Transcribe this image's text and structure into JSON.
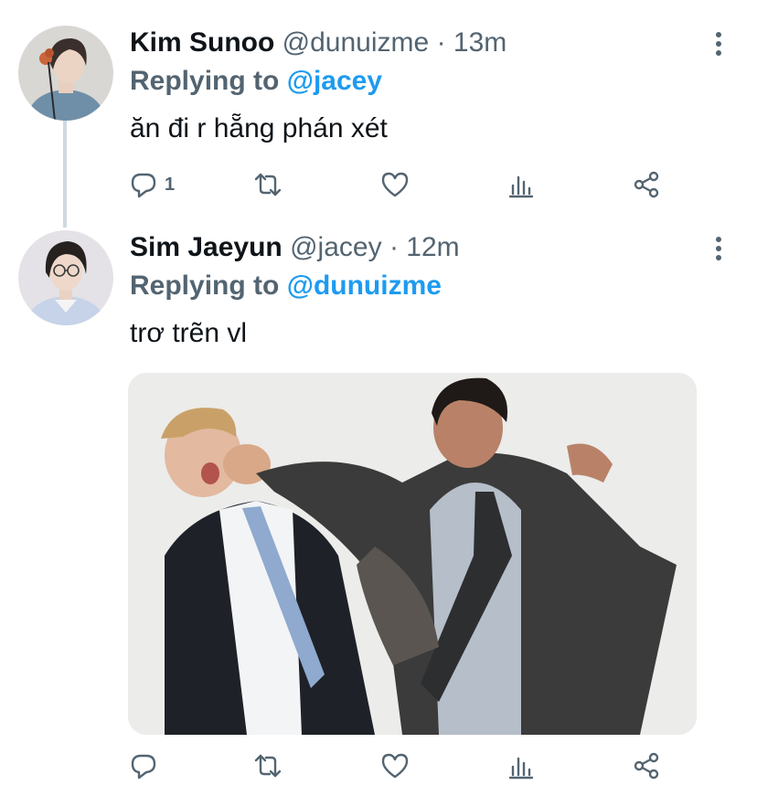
{
  "tweets": [
    {
      "display_name": "Kim Sunoo",
      "handle": "@dunuizme",
      "separator": "·",
      "time": "13m",
      "replying_label": "Replying to",
      "replying_to": "@jacey",
      "text": "ăn đi r hẵng phán xét",
      "reply_count": "1"
    },
    {
      "display_name": "Sim Jaeyun",
      "handle": "@jacey",
      "separator": "·",
      "time": "12m",
      "replying_label": "Replying to",
      "replying_to": "@dunuizme",
      "text": "trơ trẽn vl",
      "reply_count": ""
    }
  ],
  "icons": [
    "reply-icon",
    "retweet-icon",
    "like-icon",
    "analytics-icon",
    "share-icon",
    "more-icon"
  ],
  "colors": {
    "name": "#0f1419",
    "secondary": "#536471",
    "mention": "#1d9bf0",
    "thread_line": "#cfd9de"
  }
}
